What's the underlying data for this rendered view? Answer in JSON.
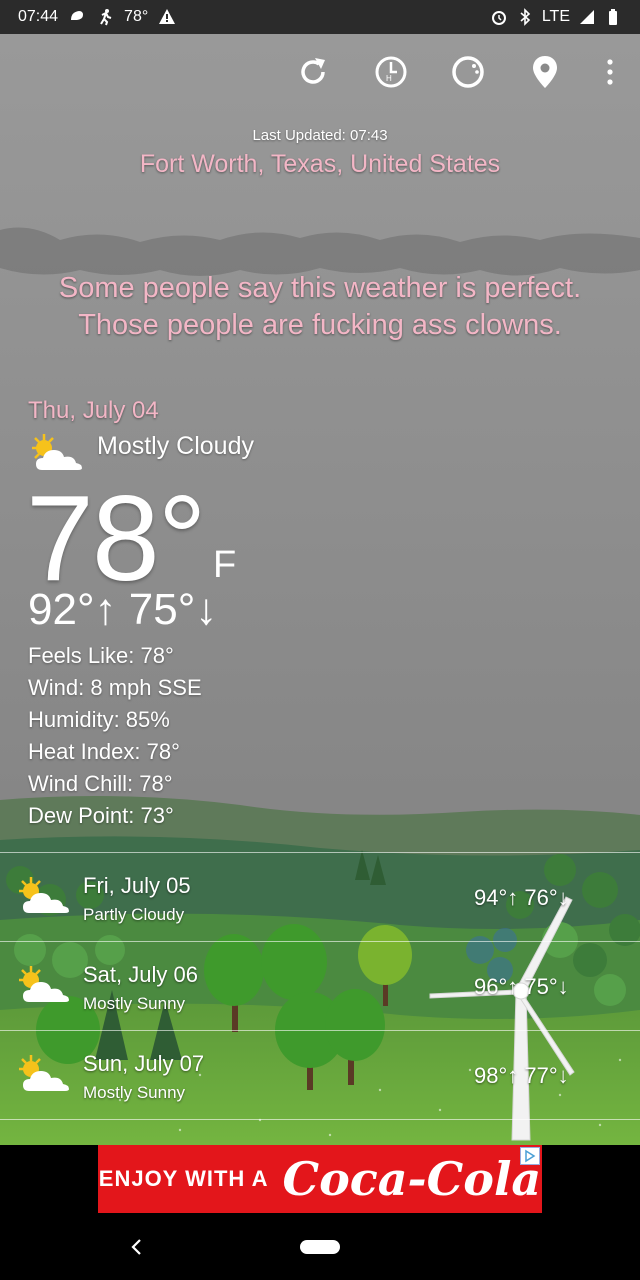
{
  "status_bar": {
    "time": "07:44",
    "temp": "78°",
    "network": "LTE"
  },
  "toolbar": {
    "icons": [
      "refresh-icon",
      "history-icon",
      "theme-icon",
      "location-pin-icon",
      "more-vert-icon"
    ]
  },
  "last_updated": "Last Updated: 07:43",
  "location": "Fort Worth, Texas, United States",
  "quote": {
    "line1": "Some people say this weather is perfect.",
    "line2": "Those people are fucking ass clowns."
  },
  "today": {
    "date": "Thu, July 04",
    "condition": "Mostly Cloudy",
    "temp": "78°",
    "unit": "F",
    "hilo": "92°↑ 75°↓",
    "feels_like": "Feels Like: 78°",
    "wind": "Wind: 8 mph SSE",
    "humidity": "Humidity: 85%",
    "heat_index": "Heat Index: 78°",
    "wind_chill": "Wind Chill: 78°",
    "dew_point": "Dew Point: 73°"
  },
  "forecast": [
    {
      "date": "Fri, July 05",
      "condition": "Partly Cloudy",
      "temps": "94°↑ 76°↓"
    },
    {
      "date": "Sat, July 06",
      "condition": "Mostly Sunny",
      "temps": "96°↑ 75°↓"
    },
    {
      "date": "Sun, July 07",
      "condition": "Mostly Sunny",
      "temps": "98°↑ 77°↓"
    }
  ],
  "ad": {
    "lead": "ENJOY WITH A",
    "brand": "Coca-Cola"
  },
  "colors": {
    "accent_pink": "#f3b6c6",
    "ad_red": "#e3161b",
    "sky": "#8a8a8a"
  }
}
